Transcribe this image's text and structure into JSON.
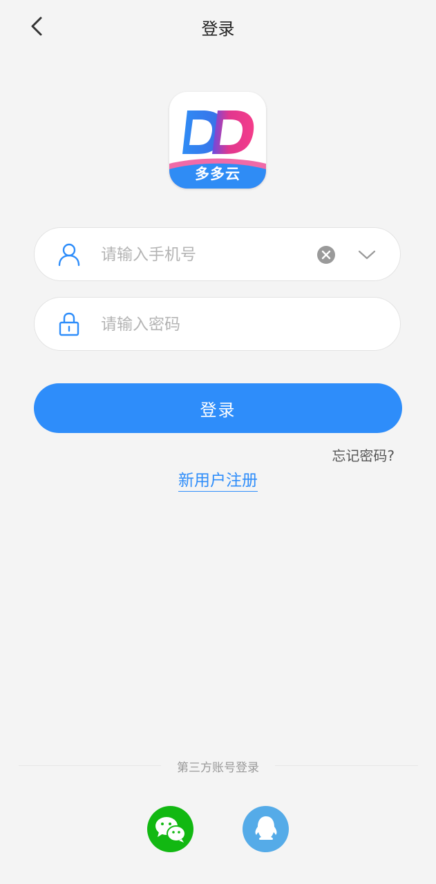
{
  "header": {
    "title": "登录",
    "back_icon": "chevron-left-icon"
  },
  "logo": {
    "name": "多多云",
    "letters": "DD"
  },
  "phone_field": {
    "placeholder": "请输入手机号",
    "value": "",
    "icon": "user-icon"
  },
  "password_field": {
    "placeholder": "请输入密码",
    "value": "",
    "icon": "lock-icon"
  },
  "login_button": {
    "label": "登录"
  },
  "forgot_link": {
    "label": "忘记密码?"
  },
  "register_link": {
    "label": "新用户注册"
  },
  "third_party": {
    "label": "第三方账号登录",
    "providers": [
      "wechat-icon",
      "qq-icon"
    ]
  },
  "colors": {
    "accent": "#2e8dfa",
    "wechat": "#12b812",
    "qq": "#55abe8",
    "background": "#f4f4f4"
  }
}
